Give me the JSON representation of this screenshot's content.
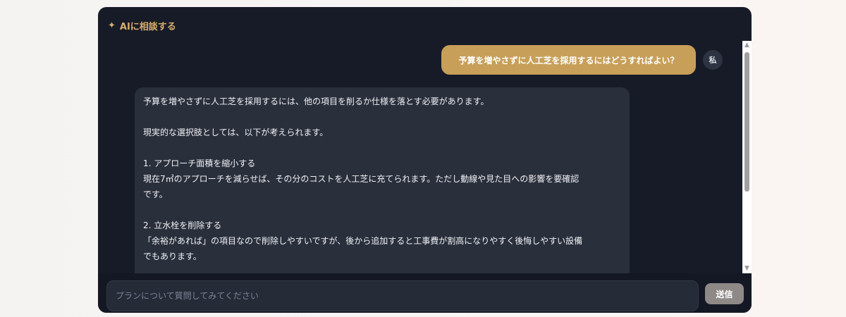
{
  "header": {
    "sparkle": "✦",
    "title": "AIに相談する"
  },
  "chat": {
    "user_message": "予算を増やさずに人工芝を採用するにはどうすればよい？",
    "user_avatar": "私",
    "ai_lines": [
      "予算を増やさずに人工芝を採用するには、他の項目を削るか仕様を落とす必要があります。",
      "",
      "現実的な選択肢としては、以下が考えられます。",
      "",
      "1. アプローチ面積を縮小する",
      "現在7㎡のアプローチを減らせば、その分のコストを人工芝に充てられます。ただし動線や見た目への影響を要確認",
      "です。",
      "",
      "2. 立水栓を削除する",
      "「余裕があれば」の項目なので削除しやすいですが、後から追加すると工事費が割高になりやすく後悔しやすい設備",
      "でもあります。"
    ]
  },
  "scrollbar": {
    "up_arrow": "▲",
    "down_arrow": "▼"
  },
  "input": {
    "placeholder": "プランについて質問してみてください",
    "value": ""
  },
  "send_button": {
    "label": "送信"
  }
}
